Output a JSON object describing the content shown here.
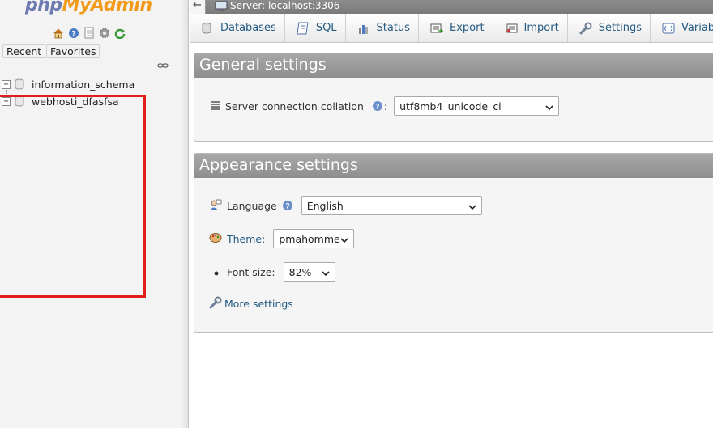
{
  "sidebar": {
    "logo_php": "php",
    "logo_myadmin": "MyAdmin",
    "nav_icons": [
      "home-icon",
      "help-icon",
      "docs-icon",
      "settings-gear-icon",
      "reload-icon"
    ],
    "recent_label": "Recent",
    "favorites_label": "Favorites",
    "databases": [
      {
        "name": "information_schema"
      },
      {
        "name": "webhosti_dfasfsa"
      }
    ]
  },
  "topbar": {
    "server_label": "Server: localhost:3306"
  },
  "tabs": [
    {
      "label": "Databases",
      "icon": "database-icon"
    },
    {
      "label": "SQL",
      "icon": "sql-icon"
    },
    {
      "label": "Status",
      "icon": "status-icon"
    },
    {
      "label": "Export",
      "icon": "export-icon"
    },
    {
      "label": "Import",
      "icon": "import-icon"
    },
    {
      "label": "Settings",
      "icon": "wrench-icon"
    },
    {
      "label": "Variables",
      "icon": "variables-icon"
    }
  ],
  "general": {
    "title": "General settings",
    "collation_label": "Server connection collation",
    "collation_suffix": ":",
    "collation_value": "utf8mb4_unicode_ci"
  },
  "appearance": {
    "title": "Appearance settings",
    "language_label": "Language",
    "language_value": "English",
    "theme_label": "Theme:",
    "theme_value": "pmahomme",
    "fontsize_label": "Font size:",
    "fontsize_value": "82%",
    "more_settings": "More settings"
  },
  "colors": {
    "accent_link": "#235a81",
    "highlight_box": "#e41b1b",
    "panel_header": "#9a9a9a"
  }
}
